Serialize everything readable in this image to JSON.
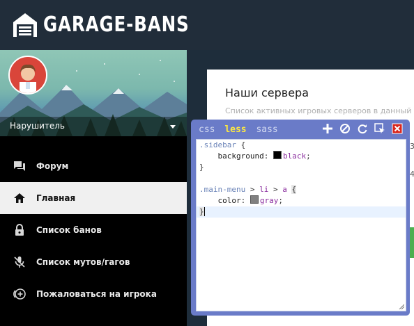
{
  "header": {
    "logo_text": "GARAGE-BANS",
    "logo_icon": "garage-icon"
  },
  "sidebar": {
    "user": {
      "name": "Нарушитель",
      "avatar_icon": "avatar-icon",
      "dropdown_icon": "caret-down-icon"
    },
    "items": [
      {
        "label": "Форум",
        "icon": "chat-icon",
        "active": false
      },
      {
        "label": "Главная",
        "icon": "home-icon",
        "active": true
      },
      {
        "label": "Список банов",
        "icon": "lock-icon",
        "active": false
      },
      {
        "label": "Список мутов/гагов",
        "icon": "mic-off-icon",
        "active": false
      },
      {
        "label": "Пожаловаться на игрока",
        "icon": "add-circle-icon",
        "active": false
      }
    ]
  },
  "main": {
    "title": "Наши сервера",
    "subtitle": "Список активных игровых серверов в данный м",
    "fragments": [
      "3",
      "4"
    ]
  },
  "editor": {
    "tabs": [
      "css",
      "less",
      "sass"
    ],
    "active_tab": "less",
    "tools": [
      "plus-icon",
      "disable-icon",
      "refresh-icon",
      "pick-element-icon",
      "close-icon"
    ],
    "code": {
      "line1_selector": ".sidebar",
      "line1_brace": " {",
      "line2_prop": "background",
      "line2_value": "black",
      "line3": "}",
      "line5_sel_a": ".main-menu",
      "line5_gt1": " > ",
      "line5_sel_b": "li",
      "line5_gt2": " > ",
      "line5_sel_c": "a",
      "line5_brace": "{",
      "line6_prop": "color",
      "line6_value": "gray",
      "line7": "}"
    },
    "colors": {
      "black": "#000000",
      "gray": "#808080",
      "active_tab": "#ffea3f",
      "panel": "#6a7bc8"
    }
  }
}
